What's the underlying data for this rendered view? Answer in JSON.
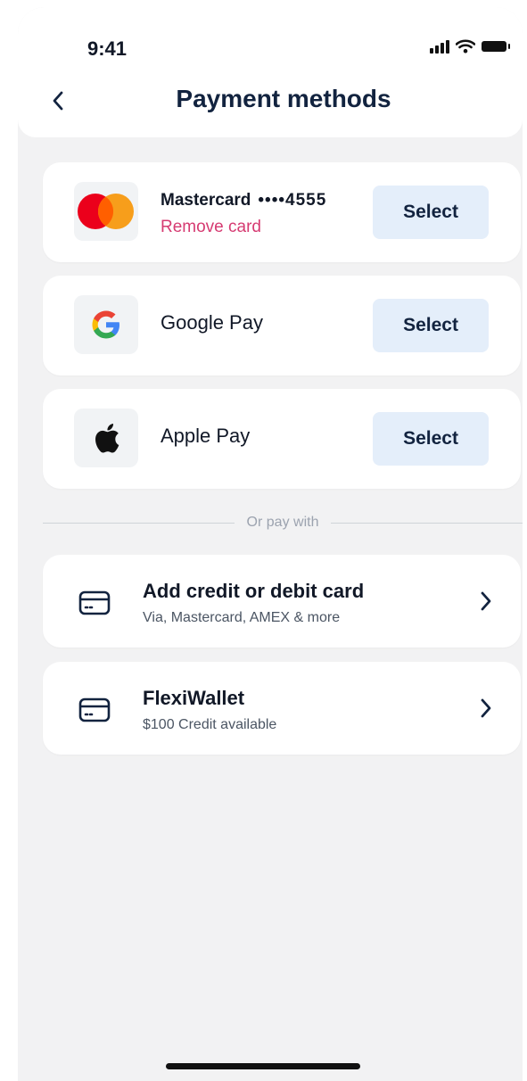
{
  "status_bar": {
    "time": "9:41"
  },
  "header": {
    "title": "Payment methods"
  },
  "methods": [
    {
      "name": "Mastercard",
      "masked_number": "••••4555",
      "remove_label": "Remove card",
      "select_label": "Select"
    },
    {
      "name": "Google Pay",
      "select_label": "Select"
    },
    {
      "name": "Apple Pay",
      "select_label": "Select"
    }
  ],
  "divider": {
    "label": "Or pay with"
  },
  "options": [
    {
      "title": "Add credit or debit card",
      "subtitle": "Via, Mastercard, AMEX & more"
    },
    {
      "title": "FlexiWallet",
      "subtitle": "$100 Credit available"
    }
  ],
  "colors": {
    "background": "#f2f2f3",
    "title_text": "#12233f",
    "select_button_bg": "#e4eefa",
    "remove_link": "#d63b72",
    "mastercard_red": "#eb001b",
    "mastercard_orange": "#f79e1b"
  },
  "icons": [
    "signal-icon",
    "wifi-icon",
    "battery-icon",
    "back-arrow-icon",
    "mastercard-logo",
    "google-logo",
    "apple-logo",
    "card-icon",
    "chevron-right-icon"
  ]
}
